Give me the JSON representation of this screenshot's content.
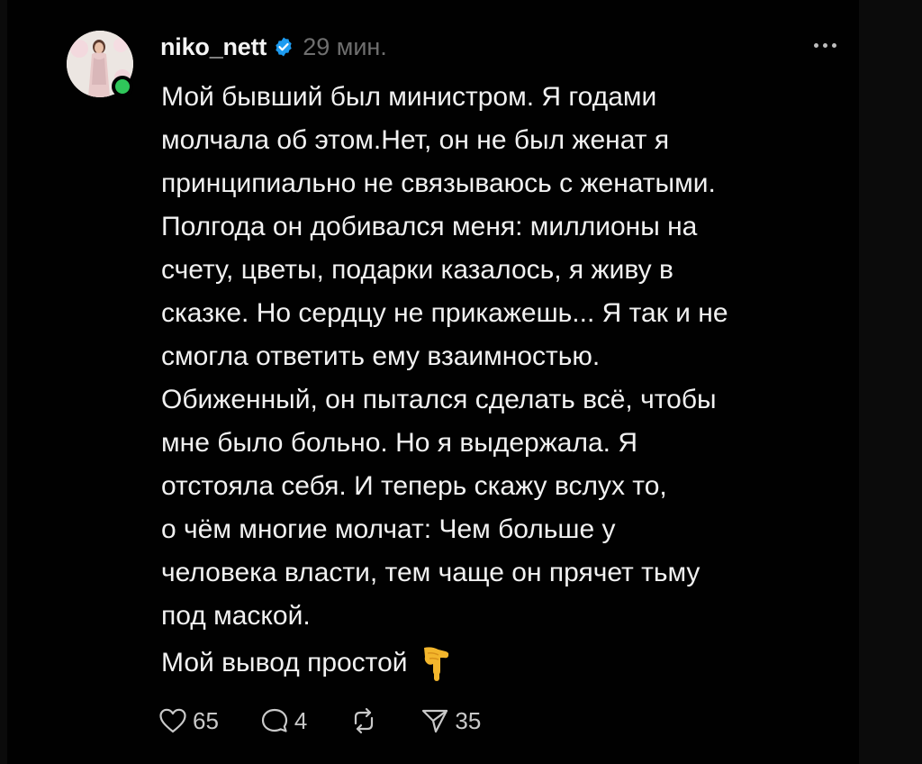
{
  "post": {
    "author": "niko_nett",
    "time": "29 мин.",
    "verified": true,
    "text": "Мой бывший был министром. Я годами\nмолчала об этом.Нет, он не был женат я\nпринципиально не связываюсь с женатыми.\nПолгода он добивался меня: миллионы на\nсчету, цветы, подарки казалось, я живу в\nсказке. Но сердцу не прикажешь... Я так и не\nсмогла ответить ему взаимностью.\nОбиженный, он пытался сделать всё, чтобы\nмне было больно. Но я выдержала. Я\nотстояла себя. И теперь скажу вслух то,\nо чём многие молчат: Чем больше у\nчеловека власти, тем чаще он прячет тьму\nпод маской.",
    "conclusion": "Мой вывод простой"
  },
  "actions": {
    "likes": "65",
    "comments": "4",
    "shares": "35"
  },
  "icons": {
    "like": "heart-icon",
    "comment": "comment-bubble-icon",
    "repost": "repost-icon",
    "share": "send-icon",
    "more": "more-dots-icon",
    "verified": "verified-badge-icon",
    "emoji": "backhand-index-pointing-down-emoji"
  },
  "colors": {
    "background": "#010101",
    "text": "#f1f1f1",
    "muted": "#6f6f6f",
    "verified": "#1d9bf0",
    "online": "#2fc75a"
  }
}
